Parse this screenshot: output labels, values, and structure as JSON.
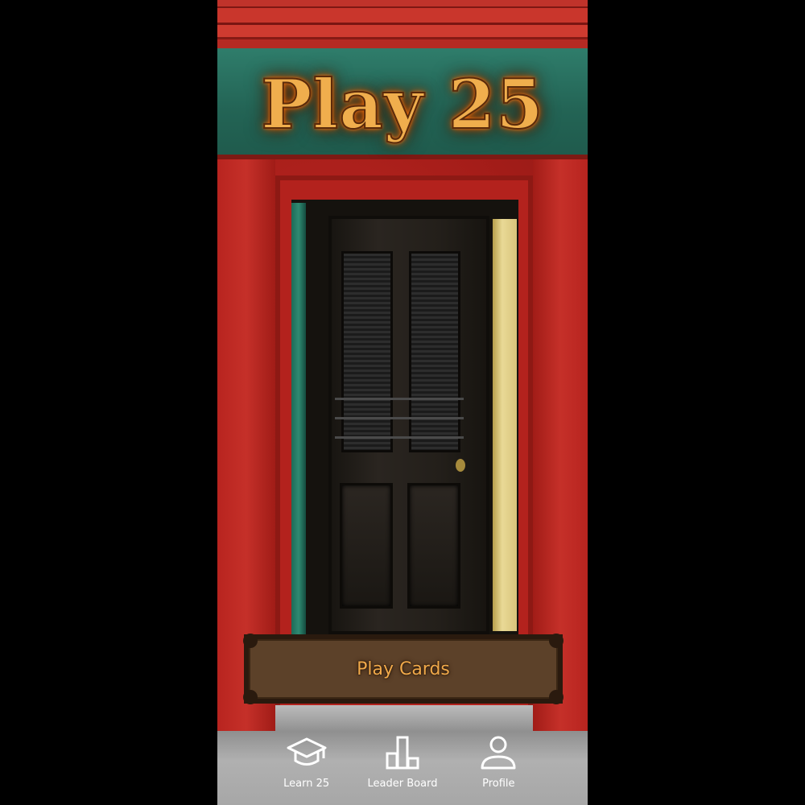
{
  "app": {
    "title": "Play 25"
  },
  "main": {
    "play_button_label": "Play Cards"
  },
  "nav": {
    "items": [
      {
        "label": "Learn 25",
        "icon": "graduation-cap-icon"
      },
      {
        "label": "Leader Board",
        "icon": "bar-chart-icon"
      },
      {
        "label": "Profile",
        "icon": "user-icon"
      }
    ]
  },
  "colors": {
    "title": "#f0ae4d",
    "button_text": "#f0a94a",
    "button_bg": "#5c4129",
    "wall_red": "#b3201d",
    "fascia_green": "#236455"
  }
}
